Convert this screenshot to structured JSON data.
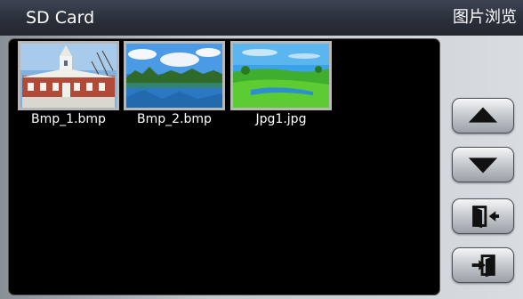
{
  "title": {
    "left": "SD Card",
    "right": "图片浏览"
  },
  "files": [
    {
      "name": "Bmp_1.bmp",
      "thumb_icon": "building-photo-icon"
    },
    {
      "name": "Bmp_2.bmp",
      "thumb_icon": "lake-landscape-photo-icon"
    },
    {
      "name": "Jpg1.jpg",
      "thumb_icon": "green-field-photo-icon"
    }
  ],
  "buttons": [
    {
      "name": "page-up-button",
      "icon": "triangle-up-icon"
    },
    {
      "name": "page-down-button",
      "icon": "triangle-down-icon"
    },
    {
      "name": "back-button",
      "icon": "exit-door-icon"
    },
    {
      "name": "enter-button",
      "icon": "enter-door-icon"
    }
  ],
  "colors": {
    "titlebar": "#2a2f3b",
    "browser_background": "#000000",
    "thumb_border": "#b8b8b8",
    "text": "#ffffff"
  }
}
